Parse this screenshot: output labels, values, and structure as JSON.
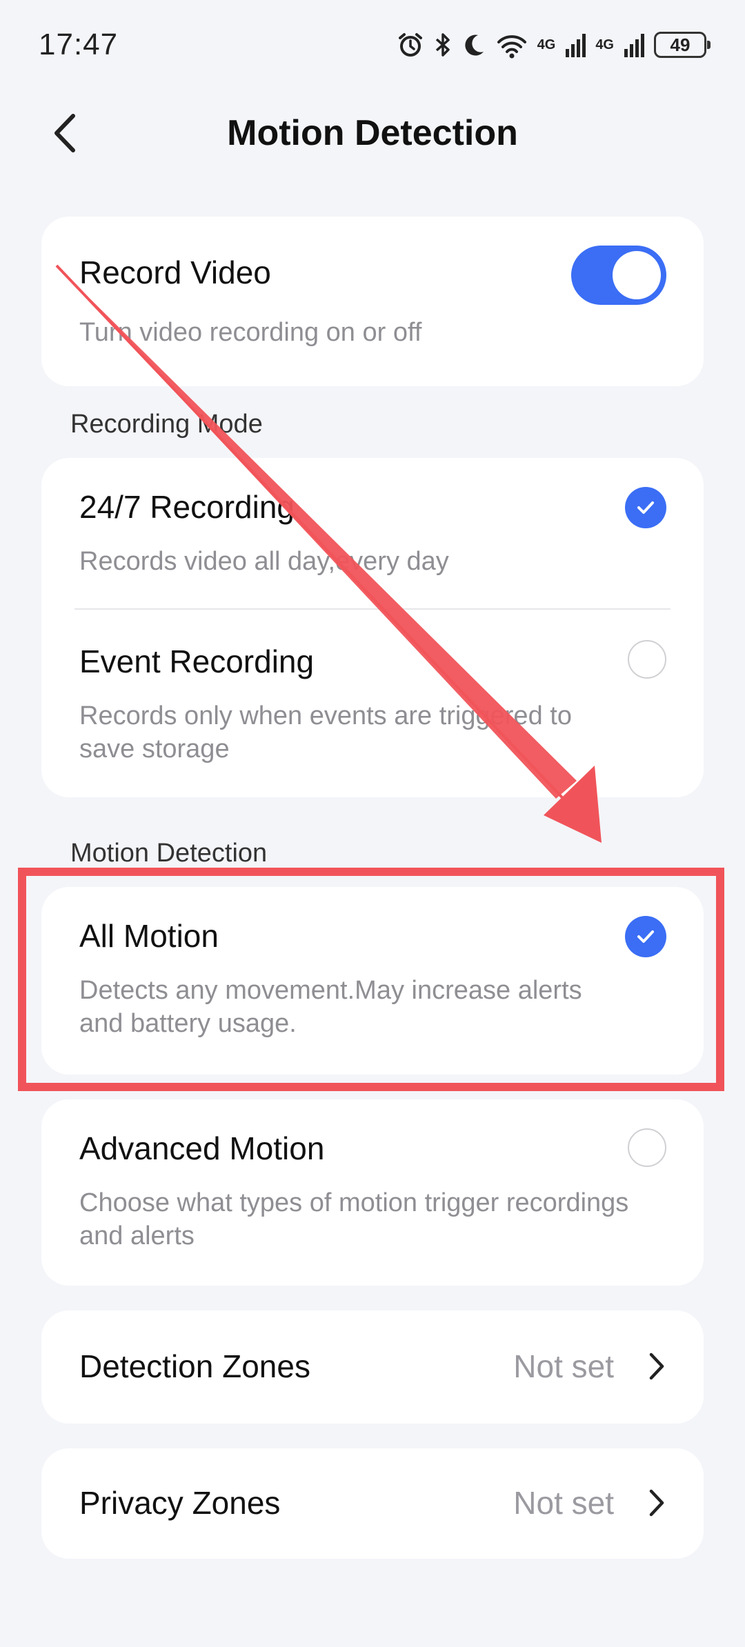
{
  "status_bar": {
    "time": "17:47",
    "network_1": "4G",
    "network_2": "4G",
    "battery": "49"
  },
  "header": {
    "title": "Motion Detection"
  },
  "record_video": {
    "title": "Record Video",
    "subtitle": "Turn video recording on or off",
    "enabled": true
  },
  "recording_mode": {
    "label": "Recording Mode",
    "options": [
      {
        "title": "24/7 Recording",
        "subtitle": "Records video all day,every day",
        "selected": true
      },
      {
        "title": "Event Recording",
        "subtitle": "Records only when events are triggered to save storage",
        "selected": false
      }
    ]
  },
  "motion_detection": {
    "label": "Motion Detection",
    "options": [
      {
        "title": "All Motion",
        "subtitle": "Detects any movement.May increase alerts and battery usage.",
        "selected": true
      },
      {
        "title": "Advanced Motion",
        "subtitle": "Choose what types of motion trigger recordings and alerts",
        "selected": false
      }
    ]
  },
  "zones": [
    {
      "title": "Detection Zones",
      "value": "Not set"
    },
    {
      "title": "Privacy Zones",
      "value": "Not set"
    }
  ],
  "colors": {
    "accent": "#3b6ef5",
    "annotation": "#f0545a",
    "background": "#f4f5f9"
  }
}
